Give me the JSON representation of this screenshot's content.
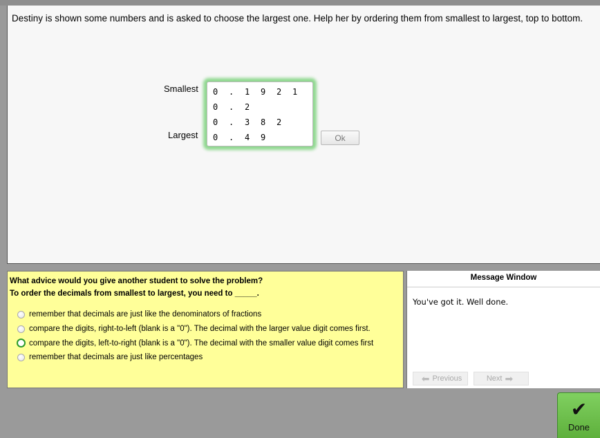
{
  "problem": {
    "instruction": "Destiny is shown some numbers and is asked to choose the largest one. Help her by ordering them from smallest to largest, top to bottom.",
    "label_smallest": "Smallest",
    "label_largest": "Largest",
    "rows": [
      [
        "0",
        ".",
        "1",
        "9",
        "2",
        "1"
      ],
      [
        "0",
        ".",
        "2"
      ],
      [
        "0",
        ".",
        "3",
        "8",
        "2"
      ],
      [
        "0",
        ".",
        "4",
        "9"
      ]
    ],
    "ok_label": "Ok"
  },
  "advice": {
    "question": "What advice would you give another student to solve the problem?",
    "prompt": "To order the decimals from smallest to largest, you need to _____.",
    "options": [
      {
        "label": "remember that decimals are just like the denominators of fractions",
        "selected": false
      },
      {
        "label": "compare the digits, right-to-left (blank is a \"0\"). The decimal with the larger value digit comes first.",
        "selected": false
      },
      {
        "label": "compare the digits, left-to-right (blank is a \"0\"). The decimal with the smaller value digit comes first",
        "selected": true
      },
      {
        "label": "remember that decimals are just like percentages",
        "selected": false
      }
    ]
  },
  "message_window": {
    "title": "Message Window",
    "text": "You've got it. Well done.",
    "previous_label": "Previous",
    "next_label": "Next"
  },
  "done_label": "Done",
  "colors": {
    "highlight_green": "#8fd88f",
    "advice_bg": "#ffff99",
    "done_green": "#6cc04a"
  }
}
